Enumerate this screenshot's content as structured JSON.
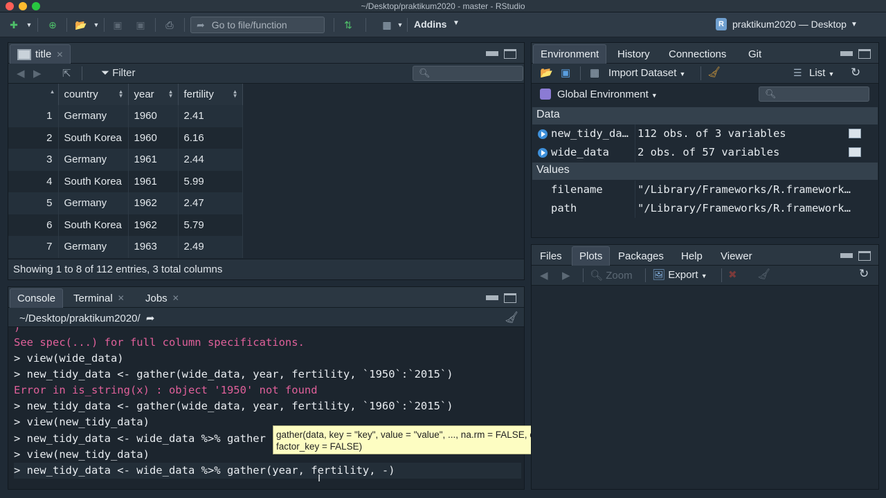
{
  "window": {
    "title": "~/Desktop/praktikum2020 - master - RStudio"
  },
  "toolbar": {
    "goto_placeholder": "Go to file/function",
    "addins_label": "Addins",
    "project_name": "praktikum2020 — Desktop",
    "project_badge": "R"
  },
  "data_viewer": {
    "tab_label": "title",
    "filter_label": "Filter",
    "columns": [
      "country",
      "year",
      "fertility"
    ],
    "rows": [
      {
        "n": "1",
        "country": "Germany",
        "year": "1960",
        "fertility": "2.41"
      },
      {
        "n": "2",
        "country": "South Korea",
        "year": "1960",
        "fertility": "6.16"
      },
      {
        "n": "3",
        "country": "Germany",
        "year": "1961",
        "fertility": "2.44"
      },
      {
        "n": "4",
        "country": "South Korea",
        "year": "1961",
        "fertility": "5.99"
      },
      {
        "n": "5",
        "country": "Germany",
        "year": "1962",
        "fertility": "2.47"
      },
      {
        "n": "6",
        "country": "South Korea",
        "year": "1962",
        "fertility": "5.79"
      },
      {
        "n": "7",
        "country": "Germany",
        "year": "1963",
        "fertility": "2.49"
      }
    ],
    "footer": "Showing 1 to 8 of 112 entries, 3 total columns"
  },
  "console_pane": {
    "tabs": [
      "Console",
      "Terminal",
      "Jobs"
    ],
    "path": "~/Desktop/praktikum2020/",
    "lines": [
      {
        "type": "err",
        "text": ")"
      },
      {
        "type": "err",
        "text": "See spec(...) for full column specifications."
      },
      {
        "type": "cmd",
        "text": "> view(wide_data)"
      },
      {
        "type": "cmd",
        "text": "> new_tidy_data <- gather(wide_data, year, fertility, `1950`:`2015`)"
      },
      {
        "type": "err",
        "text": "Error in is_string(x) : object '1950' not found"
      },
      {
        "type": "cmd",
        "text": "> new_tidy_data <- gather(wide_data, year, fertility, `1960`:`2015`)"
      },
      {
        "type": "cmd",
        "text": "> view(new_tidy_data)"
      },
      {
        "type": "cmd",
        "text": "> new_tidy_data <- wide_data %>% gather"
      },
      {
        "type": "cmd",
        "text": "> view(new_tidy_data)"
      },
      {
        "type": "cmd",
        "text": "> new_tidy_data <- wide_data %>% gather(year, fertility, -)"
      }
    ],
    "tooltip": "gather(data, key = \"key\", value = \"value\", ..., na.rm = FALSE, convert = FALSE, factor_key = FALSE)"
  },
  "environment_pane": {
    "tabs": [
      "Environment",
      "History",
      "Connections",
      "Git"
    ],
    "import_label": "Import Dataset",
    "list_label": "List",
    "env_selector": "Global Environment",
    "data_header": "Data",
    "values_header": "Values",
    "data_items": [
      {
        "name": "new_tidy_da…",
        "value": "112 obs. of 3 variables"
      },
      {
        "name": "wide_data",
        "value": "2 obs. of 57 variables"
      }
    ],
    "value_items": [
      {
        "name": "filename",
        "value": "\"/Library/Frameworks/R.framework…"
      },
      {
        "name": "path",
        "value": "\"/Library/Frameworks/R.framework…"
      }
    ]
  },
  "files_pane": {
    "tabs": [
      "Files",
      "Plots",
      "Packages",
      "Help",
      "Viewer"
    ],
    "zoom_label": "Zoom",
    "export_label": "Export"
  }
}
